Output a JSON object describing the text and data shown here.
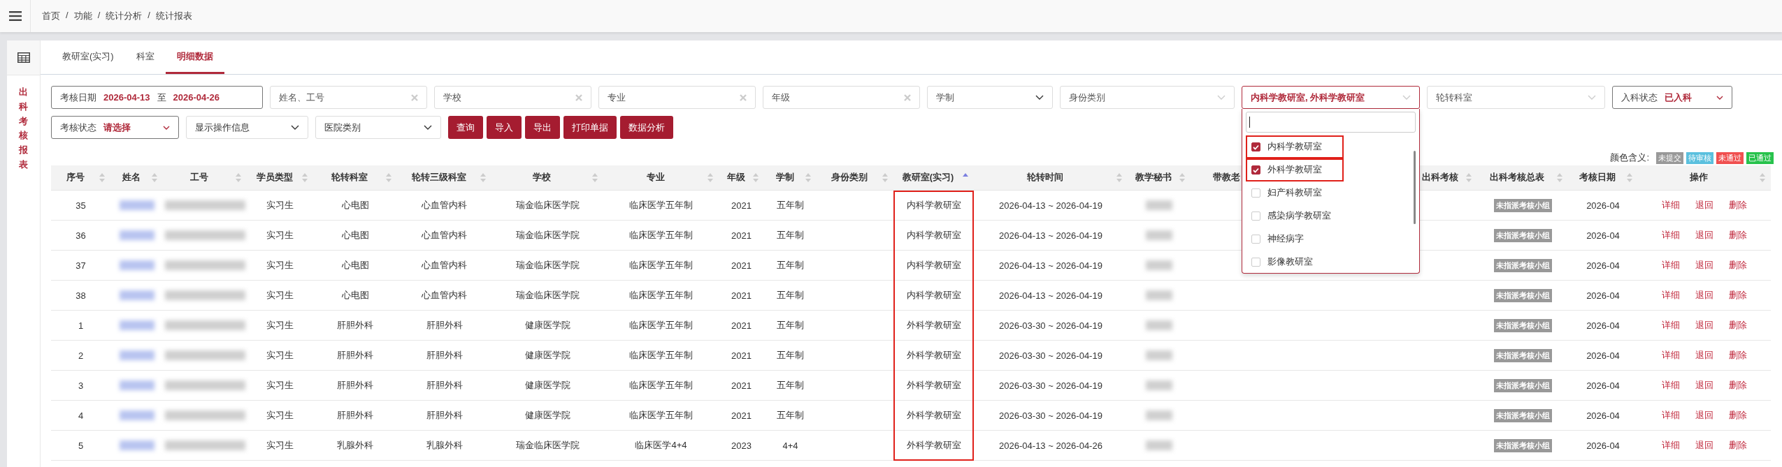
{
  "breadcrumb": {
    "separator": "/",
    "items": [
      "首页",
      "功能",
      "统计分析",
      "统计报表"
    ]
  },
  "sidebar": {
    "title": "出科考核报表"
  },
  "tabs": [
    {
      "label": "教研室(实习)",
      "selected": false
    },
    {
      "label": "科室",
      "selected": false
    },
    {
      "label": "明细数据",
      "selected": true
    }
  ],
  "filter_row_1": [
    {
      "kind": "daterange",
      "label": "考核日期",
      "from": "2026-04-13",
      "to_word": "至",
      "to": "2026-04-26"
    },
    {
      "kind": "text",
      "placeholder": "姓名、工号"
    },
    {
      "kind": "text",
      "placeholder": "学校"
    },
    {
      "kind": "text",
      "placeholder": "专业"
    },
    {
      "kind": "text",
      "placeholder": "年级"
    },
    {
      "kind": "select",
      "placeholder": "学制",
      "light": false
    },
    {
      "kind": "select",
      "placeholder": "身份类别",
      "light": true
    },
    {
      "kind": "multiselect",
      "value": "内科学教研室, 外科学教研室",
      "open": true
    },
    {
      "kind": "select",
      "placeholder": "轮转科室",
      "light": true
    },
    {
      "kind": "labelselect",
      "label": "入科状态",
      "value": "已入科"
    }
  ],
  "filter_row_2": [
    {
      "kind": "labelselect",
      "label": "考核状态",
      "value": "请选择"
    },
    {
      "kind": "select",
      "placeholder": "显示操作信息"
    },
    {
      "kind": "select",
      "placeholder": "医院类别"
    }
  ],
  "buttons": [
    "查询",
    "导入",
    "导出",
    "打印单据",
    "数据分析"
  ],
  "dropdown": {
    "options": [
      {
        "label": "内科学教研室",
        "checked": true,
        "highlighted": true
      },
      {
        "label": "外科学教研室",
        "checked": true,
        "highlighted": true
      },
      {
        "label": "妇产科教研室",
        "checked": false,
        "highlighted": false
      },
      {
        "label": "感染病学教研室",
        "checked": false,
        "highlighted": false
      },
      {
        "label": "神经病字",
        "checked": false,
        "highlighted": false
      },
      {
        "label": "影像教研室",
        "checked": false,
        "highlighted": false
      }
    ]
  },
  "legend": {
    "label": "颜色含义:",
    "items": [
      {
        "label": "未提交",
        "color": "#999999"
      },
      {
        "label": "待审核",
        "color": "#5bc0de"
      },
      {
        "label": "未通过",
        "color": "#f05050"
      },
      {
        "label": "已通过",
        "color": "#27c24c"
      }
    ]
  },
  "table": {
    "columns": [
      {
        "label": "序号",
        "sorted": false
      },
      {
        "label": "姓名",
        "sorted": false
      },
      {
        "label": "工号",
        "sorted": false
      },
      {
        "label": "学员类型",
        "sorted": false
      },
      {
        "label": "轮转科室",
        "sorted": false
      },
      {
        "label": "轮转三级科室",
        "sorted": false
      },
      {
        "label": "学校",
        "sorted": false
      },
      {
        "label": "专业",
        "sorted": false
      },
      {
        "label": "年级",
        "sorted": false
      },
      {
        "label": "学制",
        "sorted": false
      },
      {
        "label": "身份类别",
        "sorted": false
      },
      {
        "label": "教研室(实习)",
        "sorted": true,
        "highlighted": true
      },
      {
        "label": "轮转时间",
        "sorted": false
      },
      {
        "label": "教学秘书",
        "sorted": false
      },
      {
        "label": "带教老"
      },
      {
        "label": "出科考核",
        "sorted": false
      },
      {
        "label": "出科考核总表",
        "sorted": false
      },
      {
        "label": "考核日期",
        "sorted": false
      },
      {
        "label": "操作",
        "sorted": false
      }
    ],
    "rows": [
      {
        "no": "35",
        "type": "实习生",
        "dept": "心电图",
        "sub": "心血管内科",
        "school": "瑞金临床医学院",
        "major": "临床医学五年制",
        "grade": "2021",
        "program": "五年制",
        "office": "内科学教研室",
        "period": "2026-04-13 ~ 2026-04-19",
        "badge": "未指派考核小组",
        "date": "2026-04",
        "actions": [
          "详细",
          "退回",
          "删除"
        ]
      },
      {
        "no": "36",
        "type": "实习生",
        "dept": "心电图",
        "sub": "心血管内科",
        "school": "瑞金临床医学院",
        "major": "临床医学五年制",
        "grade": "2021",
        "program": "五年制",
        "office": "内科学教研室",
        "period": "2026-04-13 ~ 2026-04-19",
        "badge": "未指派考核小组",
        "date": "2026-04",
        "actions": [
          "详细",
          "退回",
          "删除"
        ]
      },
      {
        "no": "37",
        "type": "实习生",
        "dept": "心电图",
        "sub": "心血管内科",
        "school": "瑞金临床医学院",
        "major": "临床医学五年制",
        "grade": "2021",
        "program": "五年制",
        "office": "内科学教研室",
        "period": "2026-04-13 ~ 2026-04-19",
        "badge": "未指派考核小组",
        "date": "2026-04",
        "actions": [
          "详细",
          "退回",
          "删除"
        ]
      },
      {
        "no": "38",
        "type": "实习生",
        "dept": "心电图",
        "sub": "心血管内科",
        "school": "瑞金临床医学院",
        "major": "临床医学五年制",
        "grade": "2021",
        "program": "五年制",
        "office": "内科学教研室",
        "period": "2026-04-13 ~ 2026-04-19",
        "badge": "未指派考核小组",
        "date": "2026-04",
        "actions": [
          "详细",
          "退回",
          "删除"
        ]
      },
      {
        "no": "1",
        "type": "实习生",
        "dept": "肝胆外科",
        "sub": "肝胆外科",
        "school": "健康医学院",
        "major": "临床医学五年制",
        "grade": "2021",
        "program": "五年制",
        "office": "外科学教研室",
        "period": "2026-03-30 ~ 2026-04-19",
        "badge": "未指派考核小组",
        "date": "2026-04",
        "actions": [
          "详细",
          "退回",
          "删除"
        ]
      },
      {
        "no": "2",
        "type": "实习生",
        "dept": "肝胆外科",
        "sub": "肝胆外科",
        "school": "健康医学院",
        "major": "临床医学五年制",
        "grade": "2021",
        "program": "五年制",
        "office": "外科学教研室",
        "period": "2026-03-30 ~ 2026-04-19",
        "badge": "未指派考核小组",
        "date": "2026-04",
        "actions": [
          "详细",
          "退回",
          "删除"
        ]
      },
      {
        "no": "3",
        "type": "实习生",
        "dept": "肝胆外科",
        "sub": "肝胆外科",
        "school": "健康医学院",
        "major": "临床医学五年制",
        "grade": "2021",
        "program": "五年制",
        "office": "外科学教研室",
        "period": "2026-03-30 ~ 2026-04-19",
        "badge": "未指派考核小组",
        "date": "2026-04",
        "actions": [
          "详细",
          "退回",
          "删除"
        ]
      },
      {
        "no": "4",
        "type": "实习生",
        "dept": "肝胆外科",
        "sub": "肝胆外科",
        "school": "健康医学院",
        "major": "临床医学五年制",
        "grade": "2021",
        "program": "五年制",
        "office": "外科学教研室",
        "period": "2026-03-30 ~ 2026-04-19",
        "badge": "未指派考核小组",
        "date": "2026-04",
        "actions": [
          "详细",
          "退回",
          "删除"
        ]
      },
      {
        "no": "5",
        "type": "实习生",
        "dept": "乳腺外科",
        "sub": "乳腺外科",
        "school": "瑞金临床医学院",
        "major": "临床医学4+4",
        "grade": "2023",
        "program": "4+4",
        "office": "外科学教研室",
        "period": "2026-04-13 ~ 2026-04-26",
        "badge": "未指派考核小组",
        "date": "2026-04",
        "actions": [
          "详细",
          "退回",
          "删除"
        ]
      }
    ]
  }
}
